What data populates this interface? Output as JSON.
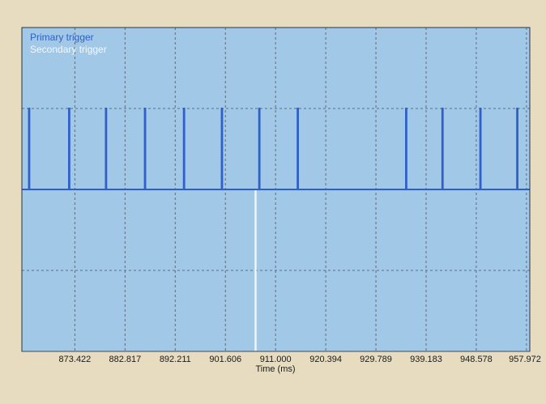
{
  "chart_data": {
    "type": "line",
    "title": "",
    "xlabel": "Time (ms)",
    "ylabel": "",
    "grid": true,
    "legend_position": "top-left",
    "xlim": [
      863.5,
      958.6
    ],
    "ylim": [
      0,
      1
    ],
    "x_ticks": [
      873.422,
      882.817,
      892.211,
      901.606,
      911.0,
      920.394,
      929.789,
      939.183,
      948.578,
      957.972
    ],
    "x_tick_labels": [
      "873.422",
      "882.817",
      "892.211",
      "901.606",
      "911.000",
      "920.394",
      "929.789",
      "939.183",
      "948.578",
      "957.972"
    ],
    "colors": {
      "plot_background": "#a2c8e8",
      "page_background": "#e8dcc0",
      "primary": "#2f5fc8",
      "secondary": "#f4f8fc",
      "grid": "#5a6c80",
      "axis": "#2a3440"
    },
    "series": [
      {
        "name": "Primary trigger",
        "baseline": 0.5,
        "pulse_level": 0.75,
        "pulse_times": [
          864.8,
          872.3,
          879.2,
          886.5,
          893.8,
          900.9,
          907.9,
          915.1,
          935.4,
          942.2,
          949.3,
          956.2
        ]
      },
      {
        "name": "Secondary trigger",
        "baseline": 0.0,
        "pulse_level": 0.5,
        "pulse_times": [
          907.2
        ]
      }
    ]
  }
}
